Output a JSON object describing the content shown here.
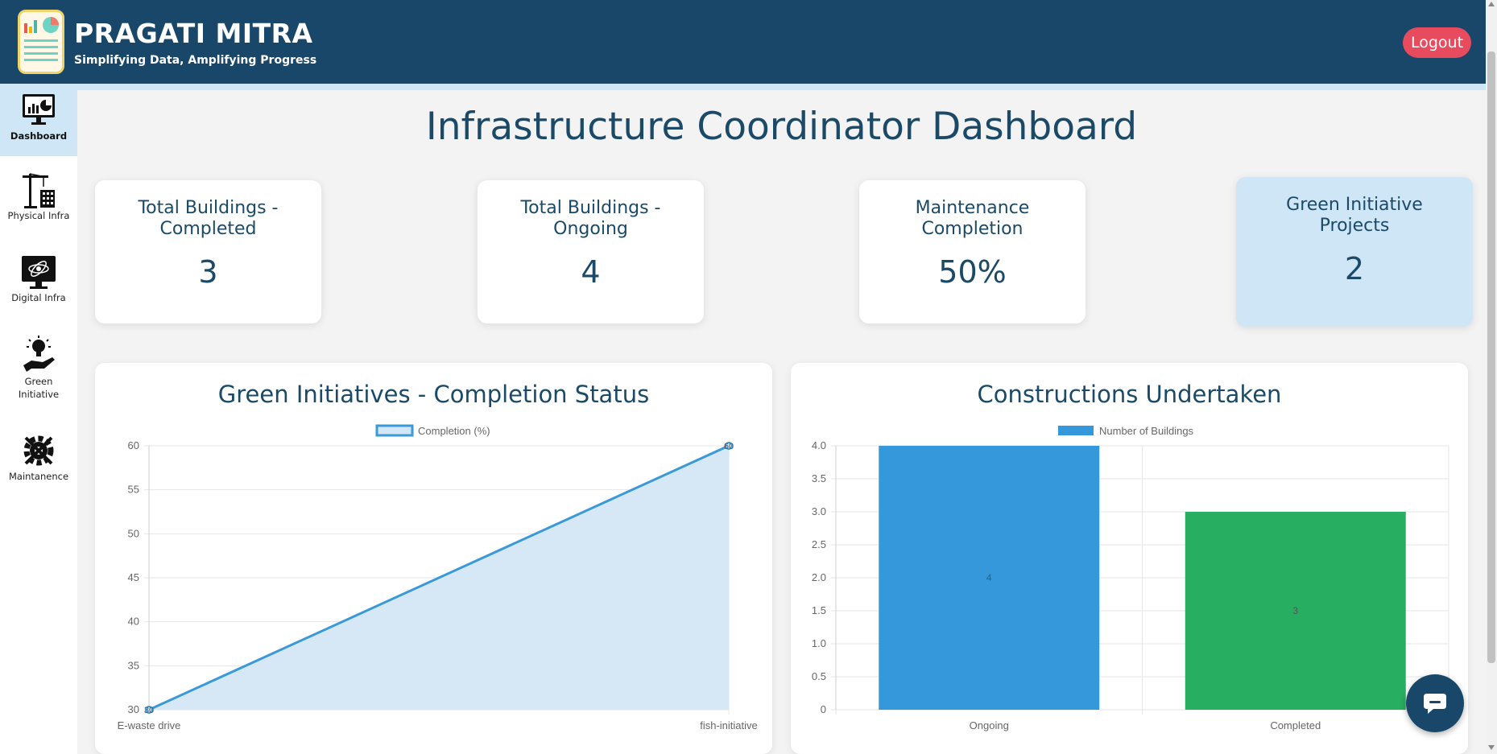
{
  "app": {
    "title": "PRAGATI MITRA",
    "tagline": "Simplifying Data, Amplifying Progress",
    "logout_label": "Logout"
  },
  "sidebar": {
    "items": [
      {
        "label": "Dashboard",
        "icon": "dashboard-monitor-icon",
        "active": true
      },
      {
        "label": "Physical Infra",
        "icon": "crane-building-icon",
        "active": false
      },
      {
        "label": "Digital Infra",
        "icon": "digital-monitor-icon",
        "active": false
      },
      {
        "label": "Green Initiative",
        "icon": "lightbulb-hand-icon",
        "active": false
      },
      {
        "label": "Maintanence",
        "icon": "gear-wrench-icon",
        "active": false
      }
    ]
  },
  "page": {
    "title": "Infrastructure Coordinator Dashboard"
  },
  "cards": [
    {
      "title": "Total Buildings - Completed",
      "value": "3"
    },
    {
      "title": "Total Buildings - Ongoing",
      "value": "4"
    },
    {
      "title": "Maintenance Completion",
      "value": "50%"
    },
    {
      "title": "Green Initiative Projects",
      "value": "2"
    }
  ],
  "charts": {
    "green": {
      "title": "Green Initiatives - Completion Status"
    },
    "constructions": {
      "title": "Constructions Undertaken"
    }
  },
  "chart_data": [
    {
      "type": "area",
      "title": "Green Initiatives - Completion Status",
      "categories": [
        "E-waste drive",
        "fish-initiative"
      ],
      "series": [
        {
          "name": "Completion (%)",
          "values": [
            30,
            60
          ]
        }
      ],
      "ylim": [
        30,
        60
      ],
      "yticks": [
        30,
        35,
        40,
        45,
        50,
        55,
        60
      ],
      "data_labels": [
        "30",
        "60"
      ],
      "color": "#3a9ad9",
      "fill": "#d4e7f6",
      "grid": true,
      "legend": "top"
    },
    {
      "type": "bar",
      "title": "Constructions Undertaken",
      "categories": [
        "Ongoing",
        "Completed"
      ],
      "series": [
        {
          "name": "Number of Buildings",
          "values": [
            4,
            3
          ]
        }
      ],
      "bar_colors": [
        "#3498db",
        "#27ae60"
      ],
      "ylim": [
        0,
        4
      ],
      "yticks": [
        "0",
        "0.5",
        "1.0",
        "1.5",
        "2.0",
        "2.5",
        "3.0",
        "3.5",
        "4.0"
      ],
      "data_labels": [
        "4",
        "3"
      ],
      "grid": true,
      "legend": "top"
    }
  ],
  "colors": {
    "header": "#18476a",
    "accent": "#cfe6f6",
    "logout": "#e84b5e",
    "text": "#1a4a67"
  },
  "chat": {
    "icon": "chat-bubble-icon"
  }
}
